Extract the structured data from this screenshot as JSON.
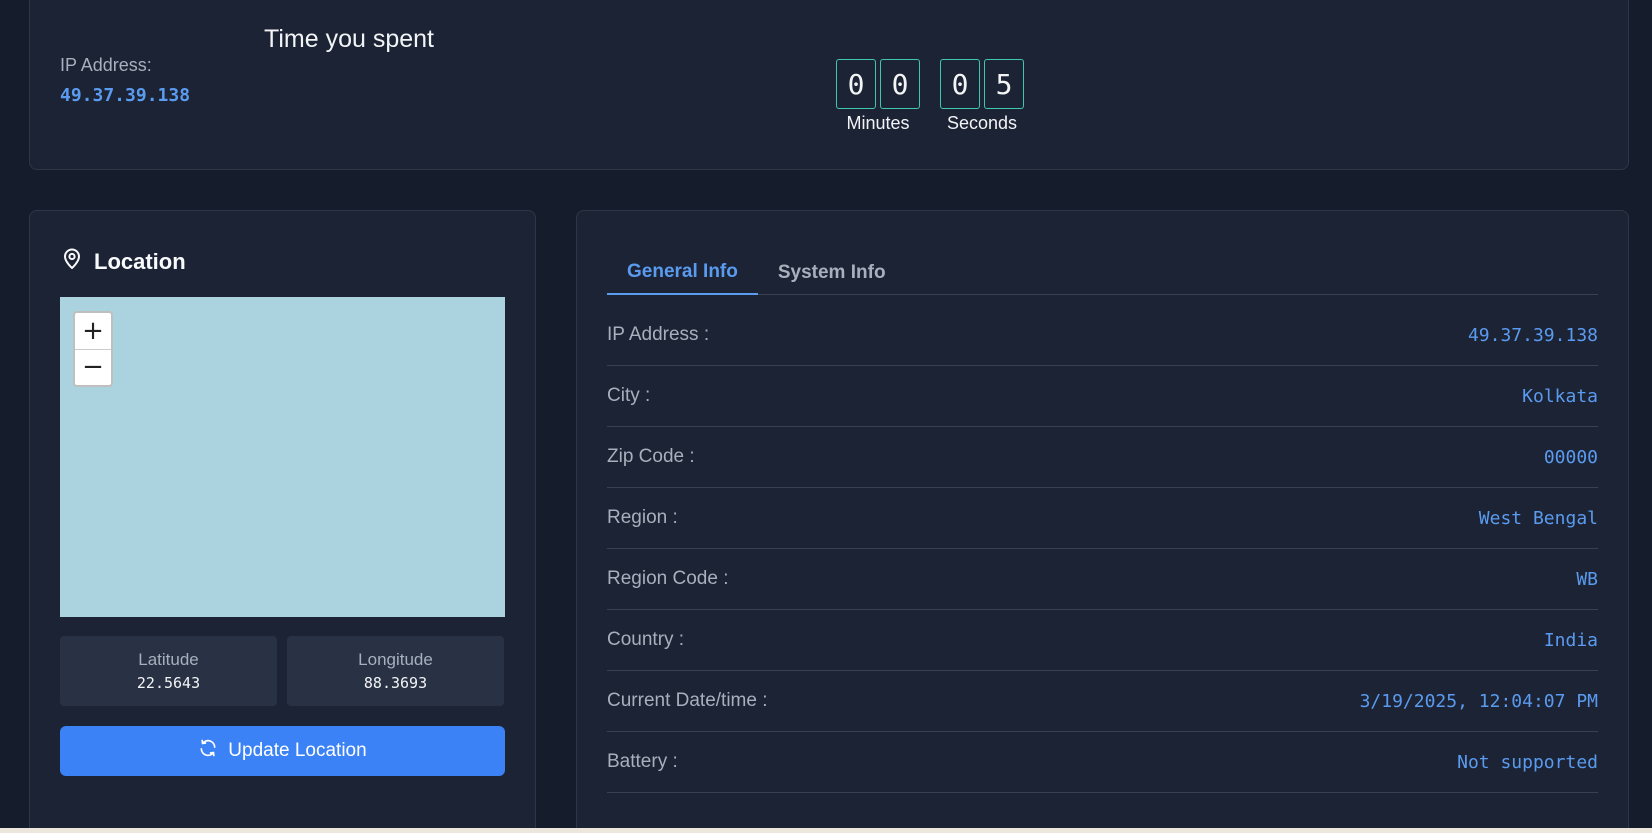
{
  "top": {
    "ip_label": "IP Address:",
    "ip_value": "49.37.39.138",
    "time_title": "Time you spent",
    "timer": {
      "minutes_digits": [
        "0",
        "0"
      ],
      "seconds_digits": [
        "0",
        "5"
      ],
      "minutes_label": "Minutes",
      "seconds_label": "Seconds"
    }
  },
  "location": {
    "title": "Location",
    "icon": "map-pin-icon",
    "zoom_in": "+",
    "zoom_out": "−",
    "latitude_label": "Latitude",
    "latitude_value": "22.5643",
    "longitude_label": "Longitude",
    "longitude_value": "88.3693",
    "update_button": "Update Location",
    "update_icon": "refresh-icon"
  },
  "info": {
    "tabs": [
      {
        "label": "General Info",
        "active": true
      },
      {
        "label": "System Info",
        "active": false
      }
    ],
    "rows": [
      {
        "label": "IP Address :",
        "value": "49.37.39.138"
      },
      {
        "label": "City :",
        "value": "Kolkata"
      },
      {
        "label": "Zip Code :",
        "value": "00000"
      },
      {
        "label": "Region :",
        "value": "West Bengal"
      },
      {
        "label": "Region Code :",
        "value": "WB"
      },
      {
        "label": "Country :",
        "value": "India"
      },
      {
        "label": "Current Date/time :",
        "value": "3/19/2025, 12:04:07 PM"
      },
      {
        "label": "Battery :",
        "value": "Not supported"
      }
    ]
  },
  "colors": {
    "background": "#151c2c",
    "card": "#1b2334",
    "accent": "#5b9bef",
    "button": "#3b82f6",
    "timer_border": "#3fc8b0",
    "map_water": "#aad3df"
  }
}
